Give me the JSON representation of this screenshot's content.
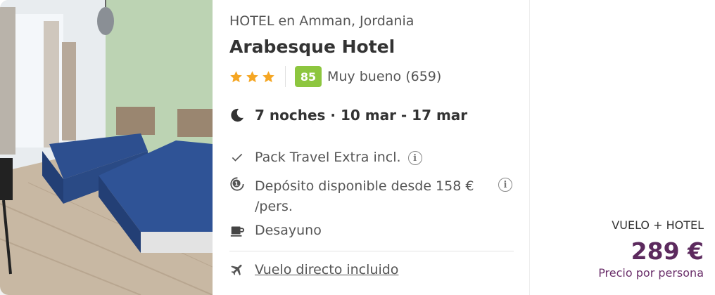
{
  "hotel": {
    "location": "HOTEL en Amman, Jordania",
    "name": "Arabesque Hotel",
    "stars": 3,
    "score": "85",
    "score_text": "Muy bueno (659)",
    "nights": "7 noches · 10 mar - 17 mar"
  },
  "features": {
    "pack": "Pack Travel Extra incl.",
    "deposit_line1": "Depósito disponible desde 158 €",
    "deposit_line2": "/pers.",
    "breakfast": "Desayuno",
    "flight": "Vuelo directo incluido"
  },
  "price": {
    "label": "VUELO + HOTEL",
    "amount": "289 €",
    "per": "Precio por persona"
  },
  "colors": {
    "accent_star": "#f5a623",
    "score_bg": "#8dc63f",
    "price": "#5c2a5e"
  }
}
